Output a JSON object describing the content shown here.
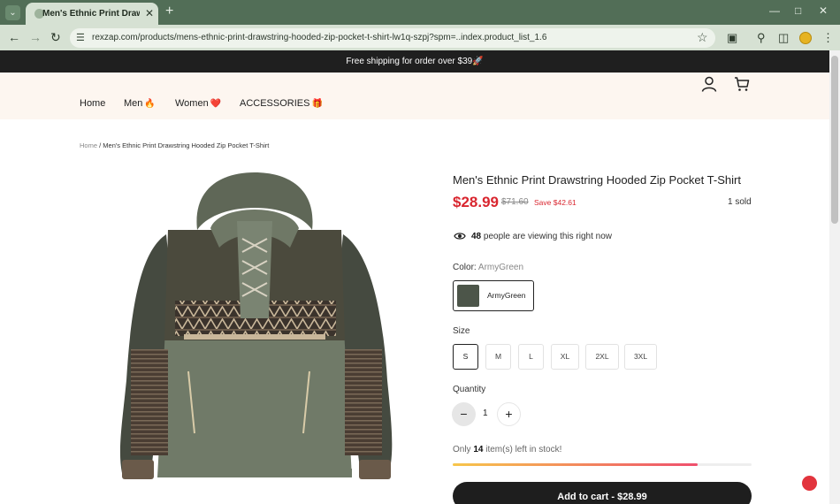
{
  "browser": {
    "tab_title": "Men's Ethnic Print Drawstring Hooded Zip Pocket T-Shirt",
    "url": "rexzap.com/products/mens-ethnic-print-drawstring-hooded-zip-pocket-t-shirt-lw1q-szpj?spm=..index.product_list_1.6"
  },
  "announcement": "Free shipping for order over $39🚀",
  "nav": {
    "items": [
      {
        "label": "Home",
        "emoji": ""
      },
      {
        "label": "Men",
        "emoji": "🔥"
      },
      {
        "label": "Women",
        "emoji": "❤️"
      },
      {
        "label": "ACCESSORIES",
        "emoji": "🎁"
      }
    ]
  },
  "breadcrumb": {
    "home": "Home",
    "separator": " / ",
    "current": "Men's Ethnic Print Drawstring Hooded Zip Pocket T-Shirt"
  },
  "product": {
    "title": "Men's Ethnic Print Drawstring Hooded Zip Pocket T-Shirt",
    "price": "$28.99",
    "compare_price": "$71.60",
    "save_text": "Save $42.61",
    "sold": "1 sold",
    "viewers_count": "48",
    "viewers_text": "people are viewing this right now",
    "color_label": "Color:",
    "color_value": "ArmyGreen",
    "color_options": [
      "ArmyGreen"
    ],
    "size_label": "Size",
    "sizes": [
      "S",
      "M",
      "L",
      "XL",
      "2XL",
      "3XL"
    ],
    "selected_size": "S",
    "quantity_label": "Quantity",
    "quantity": "1",
    "stock_prefix": "Only",
    "stock_count": "14",
    "stock_suffix": "item(s) left in stock!",
    "stock_level": 0.82,
    "add_to_cart": "Add to cart - $28.99"
  },
  "colors": {
    "accent_red": "#d9262f",
    "dark": "#1e1e1e",
    "header_bg": "#fdf6f0",
    "chrome_green": "#526e57"
  }
}
